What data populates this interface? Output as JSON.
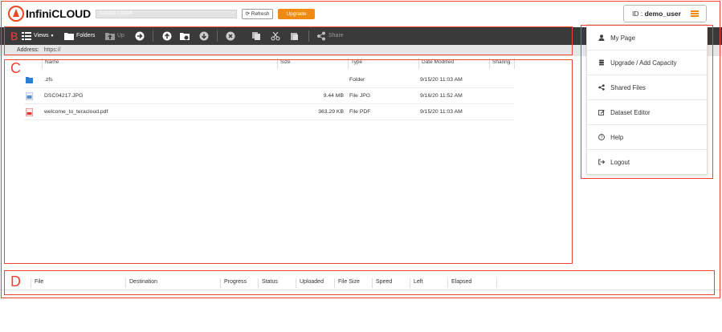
{
  "header": {
    "logo_text": "InfiniCLOUD",
    "quota_text": "0.01GB / 20GB",
    "refresh_label": "Refresh",
    "upgrade_label": "Upgrade",
    "user_prefix": "ID :",
    "user_id": "demo_user"
  },
  "toolbar": {
    "views_label": "Views",
    "folders_label": "Folders",
    "up_label": "Up",
    "share_label": "Share"
  },
  "address": {
    "label": "Address:",
    "value": "https://"
  },
  "filelist": {
    "columns": [
      "Name",
      "Size",
      "Type",
      "Date Modified",
      "Sharing"
    ],
    "rows": [
      {
        "name": ".zfs",
        "size": "",
        "type": "Folder",
        "date": "9/15/20 11:03 AM",
        "icon": "folder-icon"
      },
      {
        "name": "DSC04217.JPG",
        "size": "9.44 MB",
        "type": "File JPG",
        "date": "9/16/20 11:52 AM",
        "icon": "image-file-icon"
      },
      {
        "name": "welcome_to_teracloud.pdf",
        "size": "363.29 KB",
        "type": "File PDF",
        "date": "9/15/20 11:03 AM",
        "icon": "pdf-file-icon"
      }
    ]
  },
  "transfer": {
    "columns": [
      "File",
      "Destination",
      "Progress",
      "Status",
      "Uploaded",
      "File Size",
      "Speed",
      "Left",
      "Elapsed"
    ]
  },
  "menu": {
    "items": [
      {
        "label": "My Page",
        "icon": "user-icon"
      },
      {
        "label": "Upgrade / Add Capacity",
        "icon": "database-icon"
      },
      {
        "label": "Shared Files",
        "icon": "share-icon"
      },
      {
        "label": "Dataset Editor",
        "icon": "edit-icon"
      },
      {
        "label": "Help",
        "icon": "help-icon"
      },
      {
        "label": "Logout",
        "icon": "logout-icon"
      }
    ]
  },
  "annotations": {
    "b": "B",
    "c": "C",
    "d": "D"
  },
  "colors": {
    "accent": "#f08a12",
    "annotation": "#ee4433",
    "toolbar": "#3a3a3a"
  }
}
